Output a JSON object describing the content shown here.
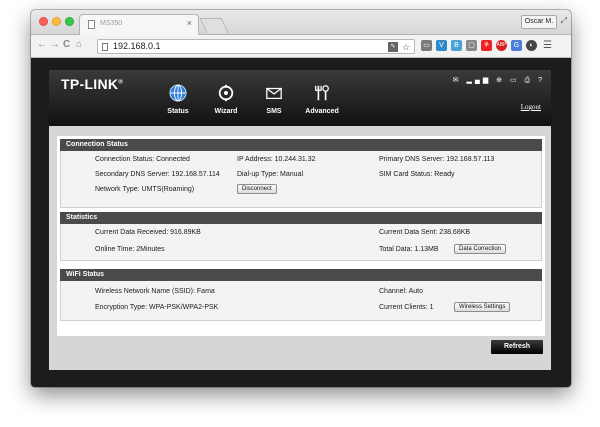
{
  "browser": {
    "tab_title": "MS350",
    "tab_close": "×",
    "user": "Oscar M.",
    "url": "192.168.0.1",
    "nav": {
      "back": "←",
      "forward": "→",
      "reload": "C",
      "home": "⌂"
    },
    "menu_icon": "☰"
  },
  "router": {
    "logo": "TP-LINK",
    "logo_mark": "®",
    "nav": [
      {
        "label": "Status",
        "icon": "globe-icon"
      },
      {
        "label": "Wizard",
        "icon": "wizard-icon"
      },
      {
        "label": "SMS",
        "icon": "envelope-icon"
      },
      {
        "label": "Advanced",
        "icon": "tools-icon"
      }
    ],
    "status_icons": "✉ ▂▄▆ ⊕ ▭ ⎙ ?",
    "logout": "Logout",
    "refresh": "Refresh"
  },
  "connection": {
    "title": "Connection Status",
    "connection_status": "Connection Status: Connected",
    "ip_address": "IP Address: 10.244.31.32",
    "primary_dns": "Primary DNS Server: 192.168.57.113",
    "secondary_dns": "Secondary DNS Server: 192.168.57.114",
    "dialup_type": "Dial-up Type: Manual",
    "sim_status": "SIM Card Status: Ready",
    "network_type": "Network Type: UMTS(Roaming)",
    "disconnect": "Disconnect"
  },
  "statistics": {
    "title": "Statistics",
    "received": "Current Data Received: 916.89KB",
    "sent": "Current Data Sent: 238.68KB",
    "online_time": "Online Time: 2Minutes",
    "total": "Total Data: 1.13MB",
    "data_correction": "Data Correction"
  },
  "wifi": {
    "title": "WiFi Status",
    "ssid": "Wireless Network Name (SSID): Fama",
    "channel": "Channel: Auto",
    "encryption": "Encryption Type: WPA-PSK/WPA2-PSK",
    "clients": "Current Clients: 1",
    "wireless_settings": "Wireless Settings"
  }
}
